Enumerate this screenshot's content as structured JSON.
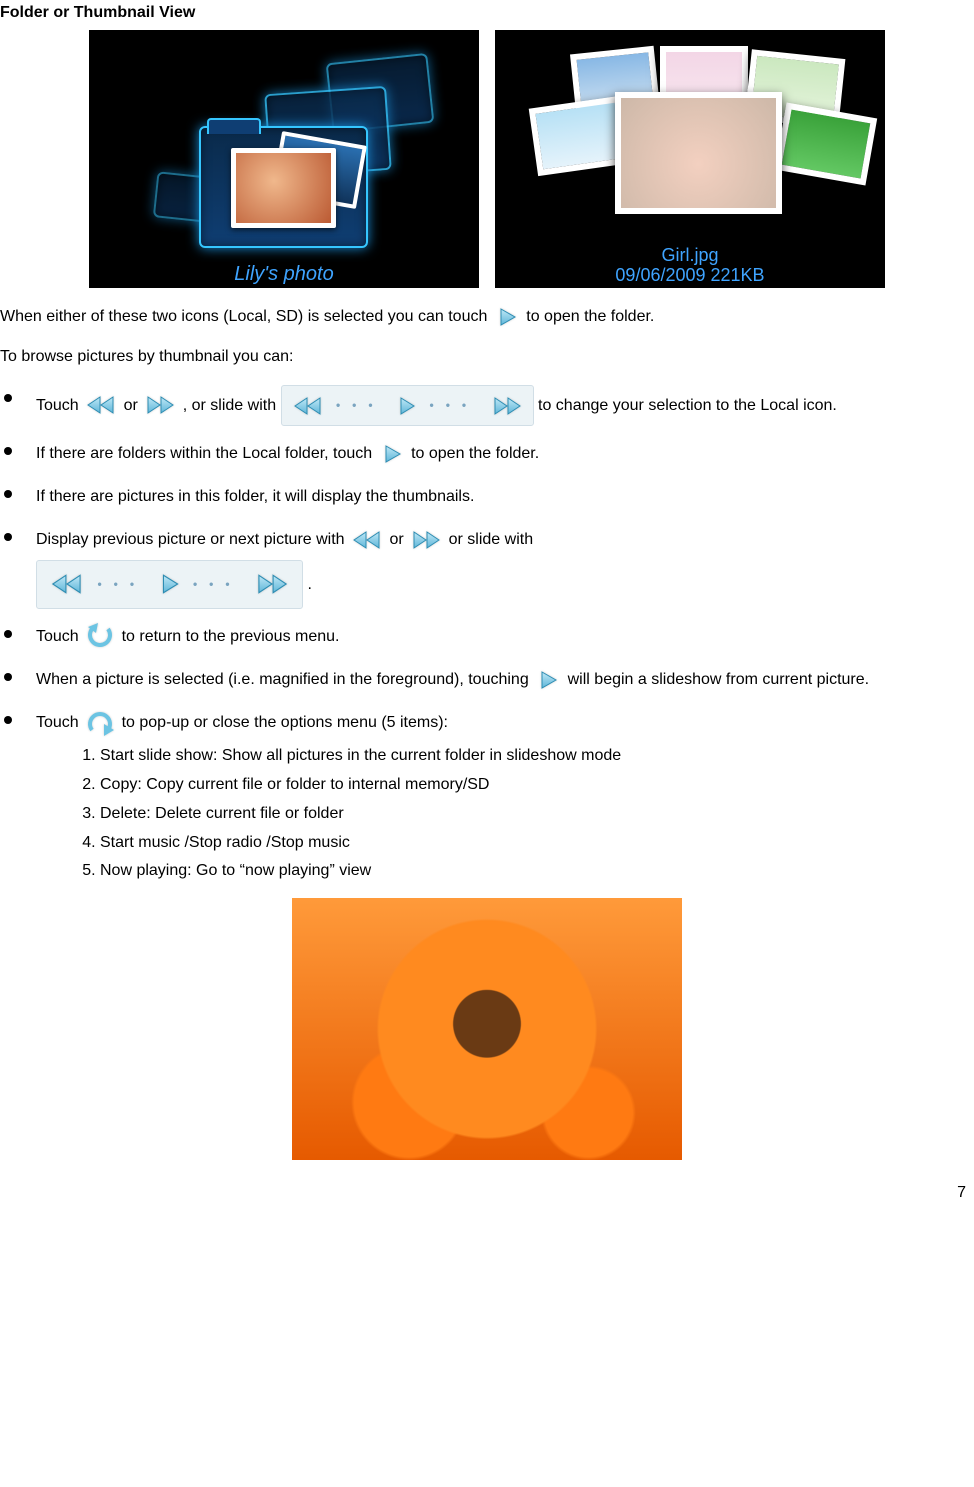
{
  "title": "Folder or Thumbnail View",
  "folderCaption": "Lily's photo",
  "thumbCaption1": "Girl.jpg",
  "thumbCaption2": "09/06/2009 221KB",
  "p1a": "When either of these two icons (Local, SD) is selected you can touch ",
  "p1b": " to open the folder.",
  "p2": "To browse pictures by thumbnail you can:",
  "b1a": "Touch ",
  "b1b": " or ",
  "b1c": ", or slide with ",
  "b1d": " to change your selection to the Local icon.",
  "b2a": "If there are folders within the Local folder, touch ",
  "b2b": " to open the folder.",
  "b3": "If there are pictures in this folder, it will display the thumbnails.",
  "b4a": "Display previous picture or next picture with ",
  "b4b": " or ",
  "b4c": " or slide with",
  "b4d": ".",
  "b5a": "Touch ",
  "b5b": " to return to the previous menu.",
  "b6a": "When a picture is selected (i.e. magnified in the foreground), touching ",
  "b6b": " will begin a slideshow from current picture.",
  "b7a": "Touch ",
  "b7b": " to pop-up or close the options menu (5 items):",
  "o1": "Start slide show: Show all pictures in the current folder in slideshow mode",
  "o2": "Copy: Copy current file or folder to internal memory/SD",
  "o3": "Delete: Delete current file or folder",
  "o4": "Start music /Stop radio /Stop music",
  "o5": "Now playing: Go to “now playing” view",
  "pageNumber": "7"
}
